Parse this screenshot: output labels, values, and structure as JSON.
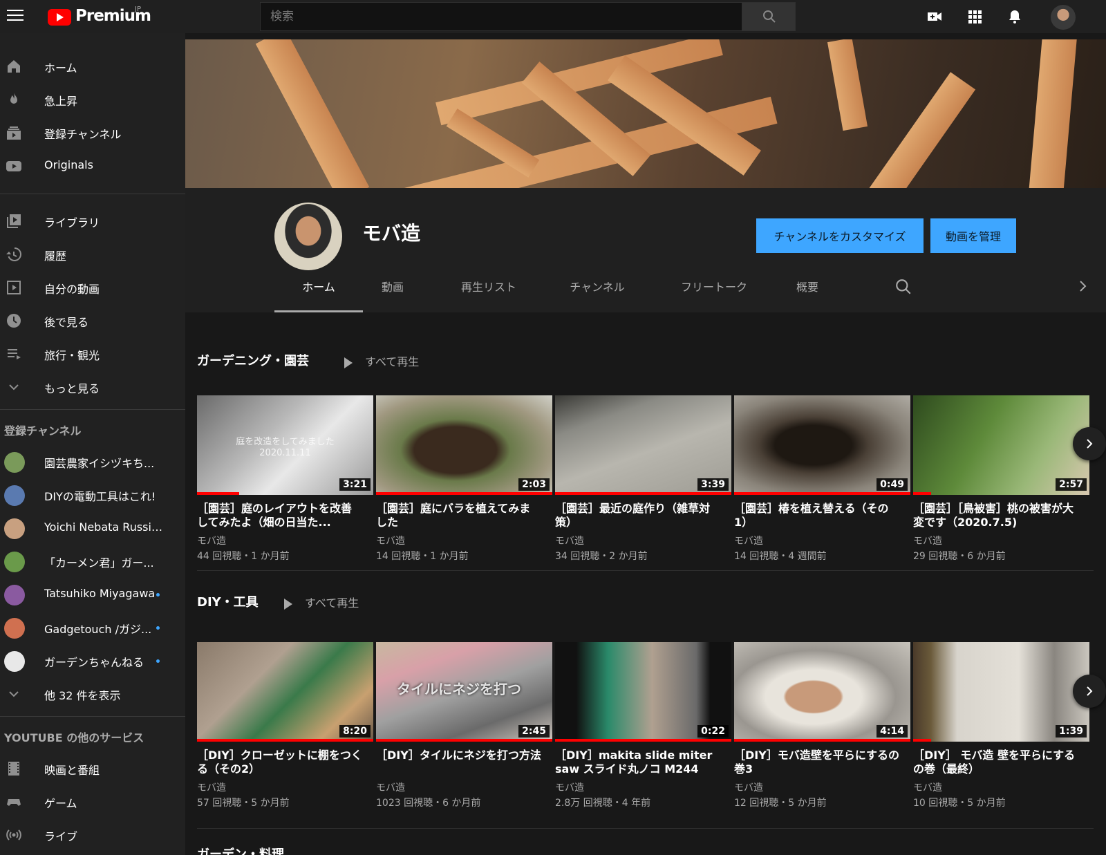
{
  "header": {
    "logo_text": "Premium",
    "logo_region": "JP",
    "search_placeholder": "検索"
  },
  "sidebar": {
    "main_items": [
      {
        "label": "ホーム",
        "icon": "home-icon"
      },
      {
        "label": "急上昇",
        "icon": "flame-icon"
      },
      {
        "label": "登録チャンネル",
        "icon": "subscriptions-icon"
      },
      {
        "label": "Originals",
        "icon": "youtube-originals-icon"
      }
    ],
    "library_items": [
      {
        "label": "ライブラリ",
        "icon": "library-icon"
      },
      {
        "label": "履歴",
        "icon": "history-icon"
      },
      {
        "label": "自分の動画",
        "icon": "my-videos-icon"
      },
      {
        "label": "後で見る",
        "icon": "clock-icon"
      },
      {
        "label": "旅行・観光",
        "icon": "playlist-icon"
      },
      {
        "label": "もっと見る",
        "icon": "chevron-down-icon"
      }
    ],
    "subscriptions_heading": "登録チャンネル",
    "subscriptions": [
      {
        "label": "園芸農家イシヅキち...",
        "color": "#7a9a5a",
        "new": false
      },
      {
        "label": "DIYの電動工具はこれ!",
        "color": "#5a7ab0",
        "new": false
      },
      {
        "label": "Yoichi Nebata Russia...",
        "color": "#c8a080",
        "new": false
      },
      {
        "label": "「カーメン君」ガー...",
        "color": "#6a9a4a",
        "new": false
      },
      {
        "label": "Tatsuhiko Miyagawa",
        "color": "#8a5aa0",
        "new": true
      },
      {
        "label": "Gadgetouch /ガジ...",
        "color": "#d07050",
        "new": true
      },
      {
        "label": "ガーデンちゃんねる",
        "color": "#e8e8e8",
        "new": true
      }
    ],
    "show_more": "他 32 件を表示",
    "other_heading": "YOUTUBE の他のサービス",
    "other_items": [
      {
        "label": "映画と番組",
        "icon": "film-icon"
      },
      {
        "label": "ゲーム",
        "icon": "gamepad-icon"
      },
      {
        "label": "ライブ",
        "icon": "live-icon"
      }
    ]
  },
  "channel": {
    "name": "モバ造",
    "customize_button": "チャンネルをカスタマイズ",
    "manage_button": "動画を管理",
    "tabs": [
      "ホーム",
      "動画",
      "再生リスト",
      "チャンネル",
      "フリートーク",
      "概要"
    ]
  },
  "shelves": [
    {
      "title": "ガーデニング・園芸",
      "play_all": "すべて再生",
      "videos": [
        {
          "title": "［園芸］庭のレイアウトを改善してみたよ（畑の日当た...",
          "channel": "モバ造",
          "meta": "44 回視聴・1 か月前",
          "duration": "3:21",
          "progress": 0.24,
          "overlay": "庭を改造をしてみました\n2020.11.11",
          "thumb_bg": "linear-gradient(135deg,#6a6a6a 0%,#b8b8b8 40%,#e8e8e8 60%,#9a9a9a 100%)"
        },
        {
          "title": "［園芸］庭にバラを植えてみました",
          "channel": "モバ造",
          "meta": "14 回視聴・1 か月前",
          "duration": "2:03",
          "progress": 1.0,
          "overlay": "",
          "thumb_bg": "radial-gradient(ellipse at 45% 55%,#3a2a1e 0 30%,#6a7a4a 40%,#a09880 70%,#d0d0c8 100%)"
        },
        {
          "title": "［園芸］最近の庭作り（雑草対策）",
          "channel": "モバ造",
          "meta": "34 回視聴・2 か月前",
          "duration": "3:39",
          "progress": 1.0,
          "overlay": "",
          "thumb_bg": "linear-gradient(160deg,#3a3a36 0%,#8a8a84 25%,#b8b6ae 55%,#9e9c94 100%)"
        },
        {
          "title": "［園芸］椿を植え替える（その1）",
          "channel": "モバ造",
          "meta": "14 回視聴・4 週間前",
          "duration": "0:49",
          "progress": 1.0,
          "overlay": "",
          "thumb_bg": "radial-gradient(ellipse at 45% 50%,#1e1812 0 28%,#4a4036 40%,#8a847a 70%,#b0aca4 100%)"
        },
        {
          "title": "［園芸］［鳥被害］桃の被害が大変です（2020.7.5)",
          "channel": "モバ造",
          "meta": "29 回視聴・6 か月前",
          "duration": "2:57",
          "progress": 0.1,
          "overlay": "",
          "thumb_bg": "linear-gradient(120deg,#2e4a1e 0%,#5e8a3a 40%,#9ab878 70%,#d8c8b0 100%)"
        }
      ]
    },
    {
      "title": "DIY・工具",
      "play_all": "すべて再生",
      "videos": [
        {
          "title": "［DIY］クローゼットに棚をつくる（その2）",
          "channel": "モバ造",
          "meta": "57 回視聴・5 か月前",
          "duration": "8:20",
          "progress": 1.0,
          "overlay": "",
          "thumb_bg": "linear-gradient(135deg,#8a7a6a 0%,#b0a090 35%,#3a7a4a 55%,#c8a070 80%,#6a5a4a 100%)"
        },
        {
          "title": "［DIY］タイルにネジを打つ方法",
          "channel": "モバ造",
          "meta": "1023 回視聴・6 か月前",
          "duration": "2:45",
          "progress": 1.0,
          "overlay": "タイルにネジを打つ",
          "thumb_bg": "linear-gradient(160deg,#c8b8a0 0%,#d8a0a8 25%,#a0a0a0 50%,#6a6a6a 75%,#d0c8c0 100%)"
        },
        {
          "title": "［DIY］makita slide miter saw スライド丸ノコ M244",
          "channel": "モバ造",
          "meta": "2.8万 回視聴・4 年前",
          "duration": "0:22",
          "progress": 1.0,
          "overlay": "",
          "thumb_bg": "linear-gradient(90deg,#111 0%,#111 12%,#2a8a6a 30%,#b0a090 55%,#6a6a6a 80%,#111 88%,#111 100%)"
        },
        {
          "title": "［DIY］モバ造壁を平らにするの巻3",
          "channel": "モバ造",
          "meta": "12 回視聴・5 か月前",
          "duration": "4:14",
          "progress": 1.0,
          "overlay": "",
          "thumb_bg": "radial-gradient(ellipse at 45% 55%,#c89a7a 0 20%,#e8e4dc 22% 35%,#9a9690 60%,#c8c4bc 100%)"
        },
        {
          "title": "［DIY］ モバ造 壁を平らにするの巻（最終）",
          "channel": "モバ造",
          "meta": "10 回視聴・5 か月前",
          "duration": "1:39",
          "progress": 0.1,
          "overlay": "",
          "thumb_bg": "linear-gradient(90deg,#4a3a2a 0%,#6a5a3a 10%,#d8d4cc 25%,#e4e0d8 60%,#8a8680 80%,#cac6be 100%)"
        }
      ]
    }
  ],
  "third_shelf_peek": "ガーデン・料理"
}
